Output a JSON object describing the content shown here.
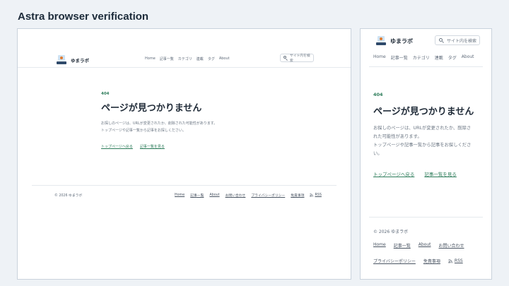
{
  "page": {
    "heading": "Astra browser verification"
  },
  "site": {
    "logo_text": "ゆまラボ",
    "nav": [
      "Home",
      "記事一覧",
      "カテゴリ",
      "連載",
      "タグ",
      "About"
    ],
    "search_placeholder": "サイト内を検索"
  },
  "error": {
    "code": "404",
    "title": "ページが見つかりません",
    "message_line1": "お探しのページは、URLが変更されたか、削除された可能性があります。",
    "message_line2": "トップページや記事一覧から記事をお探しください。",
    "link_top": "トップページへ戻る",
    "link_articles": "記事一覧を見る"
  },
  "mobile_error": {
    "message_line1": "お探しのページは、URLが変更されたか、削除さ",
    "message_line2": "れた可能性があります。",
    "message_line3": "トップページや記事一覧から記事をお探しくださ",
    "message_line4": "い。"
  },
  "footer": {
    "copyright": "© 2026 ゆまラボ",
    "links": [
      "Home",
      "記事一覧",
      "About",
      "お問い合わせ",
      "プライバシーポリシー",
      "免責事項"
    ],
    "rss": "RSS"
  },
  "colors": {
    "accent": "#2e7d5b",
    "heading": "#1f2a37",
    "muted": "#6b7683"
  },
  "icons": {
    "search": "search-icon",
    "rss": "rss-icon",
    "logo": "logo-icon"
  }
}
